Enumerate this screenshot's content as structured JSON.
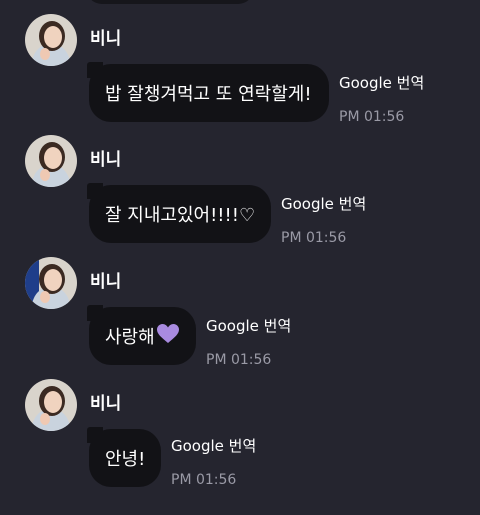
{
  "messages": [
    {
      "sender": "비니",
      "text": "밥 잘챙겨먹고 또 연락할게!",
      "translate": "Google 번역",
      "time": "PM 01:56"
    },
    {
      "sender": "비니",
      "text": "잘 지내고있어!!!!♡",
      "translate": "Google 번역",
      "time": "PM 01:56"
    },
    {
      "sender": "비니",
      "text": "사랑해",
      "emoji": "purple-heart-emoji",
      "translate": "Google 번역",
      "time": "PM 01:56"
    },
    {
      "sender": "비니",
      "text": "안녕!",
      "translate": "Google 번역",
      "time": "PM 01:56"
    }
  ],
  "colors": {
    "background": "#25252f",
    "bubble": "#121216",
    "time": "#9a9aa6",
    "heart": "#a98be0"
  }
}
